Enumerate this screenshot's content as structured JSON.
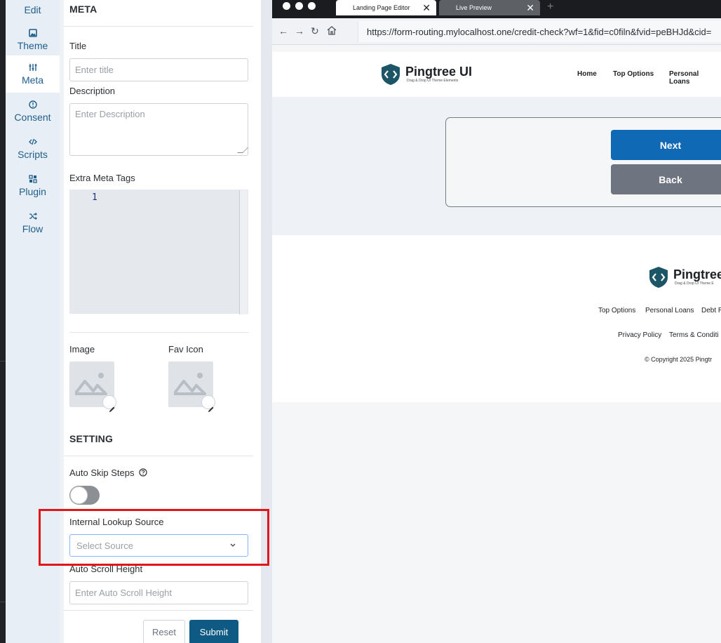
{
  "nav_rail": {
    "items": [
      {
        "label": "Edit",
        "icon": "pencil-icon"
      },
      {
        "label": "Theme",
        "icon": "image-icon"
      },
      {
        "label": "Meta",
        "icon": "sliders-icon"
      },
      {
        "label": "Consent",
        "icon": "alert-circle-icon"
      },
      {
        "label": "Scripts",
        "icon": "code-icon"
      },
      {
        "label": "Plugin",
        "icon": "grid-icon"
      },
      {
        "label": "Flow",
        "icon": "shuffle-icon"
      }
    ],
    "active": "Meta"
  },
  "panel": {
    "meta_section_title": "META",
    "title_label": "Title",
    "title_placeholder": "Enter title",
    "description_label": "Description",
    "description_placeholder": "Enter Description",
    "extra_meta_label": "Extra Meta Tags",
    "code_line_number": "1",
    "image_label": "Image",
    "favicon_label": "Fav Icon",
    "setting_section_title": "SETTING",
    "auto_skip_label": "Auto Skip Steps",
    "auto_skip_enabled": false,
    "lookup_label": "Internal Lookup Source",
    "lookup_placeholder": "Select Source",
    "scroll_height_label": "Auto Scroll Height",
    "scroll_height_placeholder": "Enter Auto Scroll Height",
    "reset_label": "Reset",
    "submit_label": "Submit"
  },
  "browser": {
    "tabs": [
      {
        "title": "Landing Page Editor",
        "active": true
      },
      {
        "title": "Live Preview",
        "active": false
      }
    ],
    "url": "https://form-routing.mylocalhost.one/credit-check?wf=1&fid=c0filn&fvid=peBHJd&cid="
  },
  "site": {
    "logo_text": "Pingtree UI",
    "logo_tagline": "Drag & Drop UI Theme Elements",
    "nav": [
      "Home",
      "Top Options",
      "Personal Loans"
    ],
    "next_label": "Next",
    "back_label": "Back",
    "footer_logo_text": "Pingtree",
    "footer_logo_tagline": "Drag & Drop UI Theme E",
    "footer_links_row1": [
      "Top Options",
      "Personal Loans",
      "Debt R"
    ],
    "footer_links_row2": [
      "Privacy Policy",
      "Terms & Conditi"
    ],
    "copyright": "© Copyright 2025 Pingtr"
  },
  "colors": {
    "accent": "#0e5a85",
    "primary_button": "#0f69b4",
    "secondary_button": "#6f7580",
    "highlight": "#e0161b"
  }
}
